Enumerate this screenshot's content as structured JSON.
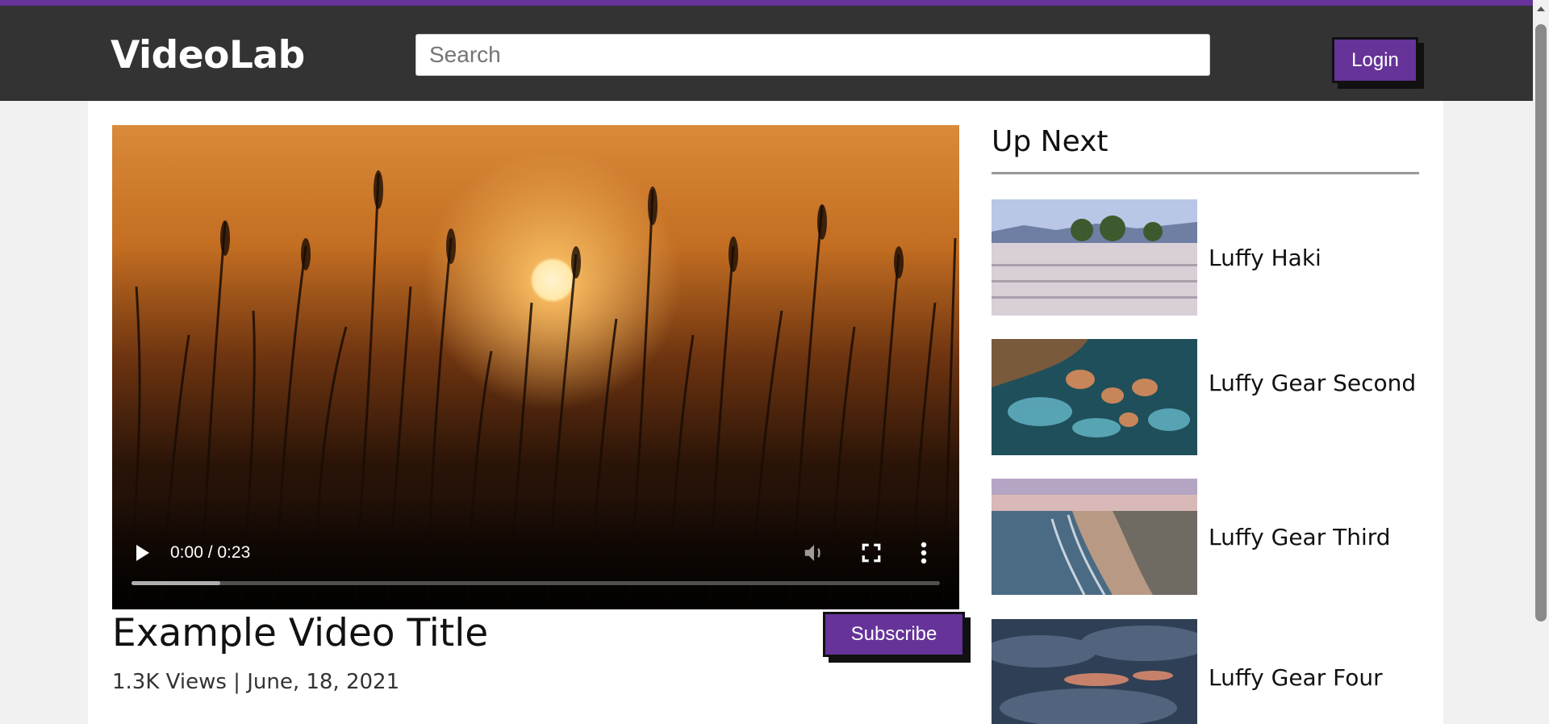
{
  "header": {
    "logo": "VideoLab",
    "search_placeholder": "Search",
    "search_value": "",
    "login_label": "Login"
  },
  "player": {
    "time": "0:00 / 0:23",
    "progress_buffered_fraction": 0.11,
    "icons": {
      "play": "play-icon",
      "volume": "volume-icon",
      "fullscreen": "fullscreen-icon",
      "more": "more-vertical-icon"
    }
  },
  "video": {
    "title": "Example Video Title",
    "meta": "1.3K Views | June, 18, 2021",
    "subscribe_label": "Subscribe"
  },
  "up_next": {
    "heading": "Up Next",
    "items": [
      {
        "label": "Luffy Haki"
      },
      {
        "label": "Luffy Gear Second"
      },
      {
        "label": "Luffy Gear Third"
      },
      {
        "label": "Luffy Gear Four"
      }
    ]
  },
  "colors": {
    "accent": "#663399",
    "header_bg": "#333333",
    "page_bg": "#f1f1f1",
    "card_bg": "#ffffff"
  }
}
